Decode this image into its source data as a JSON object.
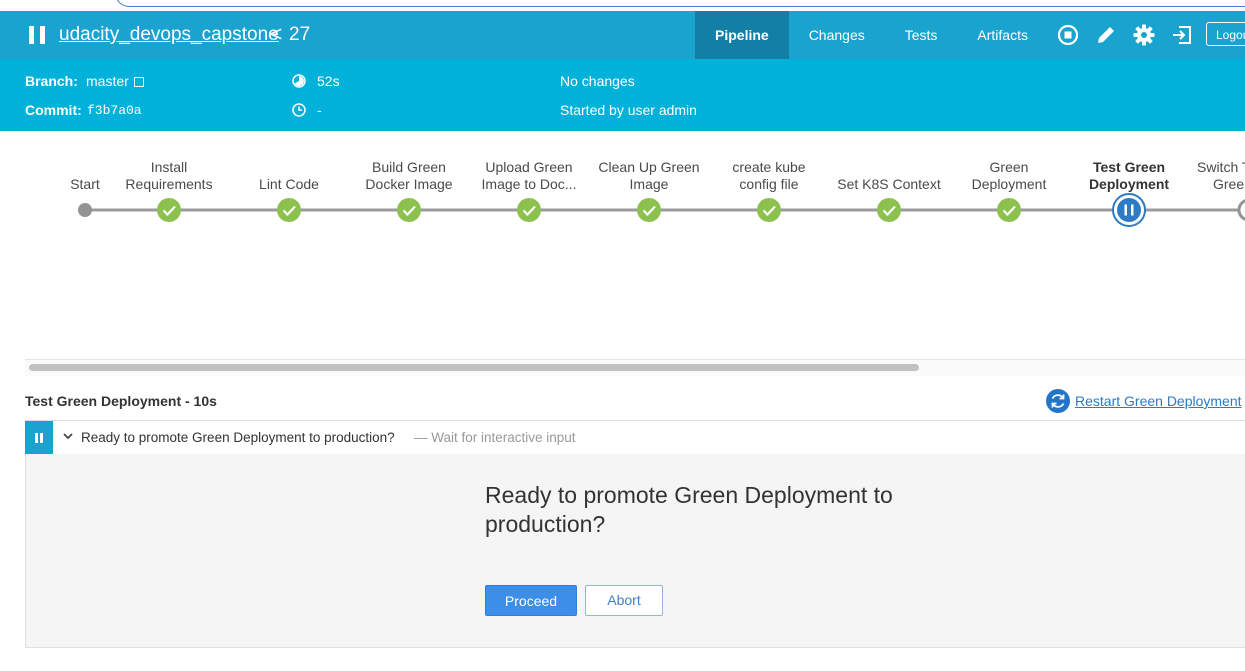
{
  "header": {
    "job_name": "udacity_devops_capstone",
    "run_separator": "<",
    "run_number": "27",
    "tabs": [
      {
        "label": "Pipeline",
        "active": true
      },
      {
        "label": "Changes",
        "active": false
      },
      {
        "label": "Tests",
        "active": false
      },
      {
        "label": "Artifacts",
        "active": false
      }
    ],
    "icons": [
      "stop-icon",
      "edit-icon",
      "settings-icon",
      "exit-icon"
    ],
    "logout_label": "Logou",
    "color": "#1aa3cf"
  },
  "meta": {
    "branch_label": "Branch:",
    "branch_value": "master",
    "commit_label": "Commit:",
    "commit_value": "f3b7a0a",
    "duration": "52s",
    "ended": "-",
    "changes": "No changes",
    "started_by": "Started by user admin",
    "color": "#00b1d9"
  },
  "pipeline": {
    "stages": [
      {
        "line1": "",
        "line2": "Start",
        "status": "start"
      },
      {
        "line1": "Install",
        "line2": "Requirements",
        "status": "success"
      },
      {
        "line1": "",
        "line2": "Lint Code",
        "status": "success"
      },
      {
        "line1": "Build Green",
        "line2": "Docker Image",
        "status": "success"
      },
      {
        "line1": "Upload Green",
        "line2": "Image to Doc...",
        "status": "success"
      },
      {
        "line1": "Clean Up Green",
        "line2": "Image",
        "status": "success"
      },
      {
        "line1": "create kube",
        "line2": "config file",
        "status": "success"
      },
      {
        "line1": "",
        "line2": "Set K8S Context",
        "status": "success"
      },
      {
        "line1": "Green",
        "line2": "Deployment",
        "status": "success"
      },
      {
        "line1": "Test Green",
        "line2": "Deployment",
        "status": "paused",
        "selected": true
      },
      {
        "line1": "Switch T",
        "line2": "Green",
        "status": "not-built"
      }
    ],
    "success_color": "#8cc04f",
    "paused_color": "#2d7bc3"
  },
  "detail": {
    "title": "Test Green Deployment - 10s",
    "restart_label": "Restart Green Deployment",
    "step_text": "Ready to promote Green Deployment to production?",
    "step_sub": "— Wait for interactive input",
    "prompt": "Ready to promote Green Deployment to production?",
    "proceed_label": "Proceed",
    "abort_label": "Abort"
  }
}
